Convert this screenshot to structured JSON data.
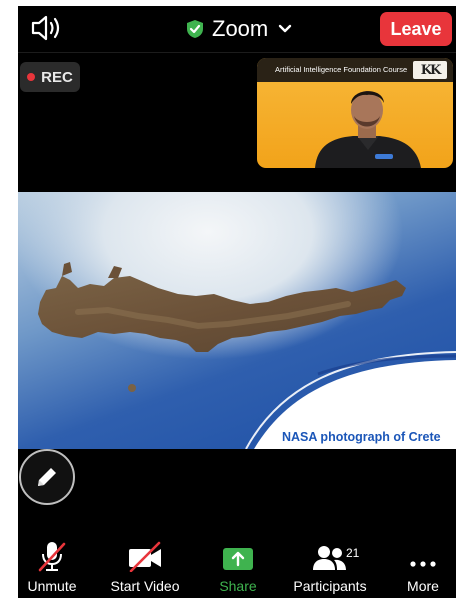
{
  "meeting": {
    "title": "Zoom",
    "leave_label": "Leave",
    "rec_label": "REC"
  },
  "thumbnail": {
    "course_title": "Artificial Intelligence Foundation Course",
    "logo_text": "KK"
  },
  "slide": {
    "caption": "NASA photograph of Crete"
  },
  "toolbar": {
    "unmute_label": "Unmute",
    "start_video_label": "Start Video",
    "share_label": "Share",
    "participants_label": "Participants",
    "participants_count": "21",
    "more_label": "More"
  },
  "colors": {
    "leave": "#e8353b",
    "rec_dot": "#e8353b",
    "share_green": "#3fb34f",
    "shield_green": "#3fb34f",
    "caption_blue": "#1b56b8"
  },
  "icons": {
    "audio": "speaker-icon",
    "security": "shield-check-icon",
    "annotate": "pencil-icon",
    "mic": "mic-off-icon",
    "video": "video-off-icon",
    "share": "share-arrow-icon",
    "participants": "people-icon",
    "more": "ellipsis-icon"
  }
}
